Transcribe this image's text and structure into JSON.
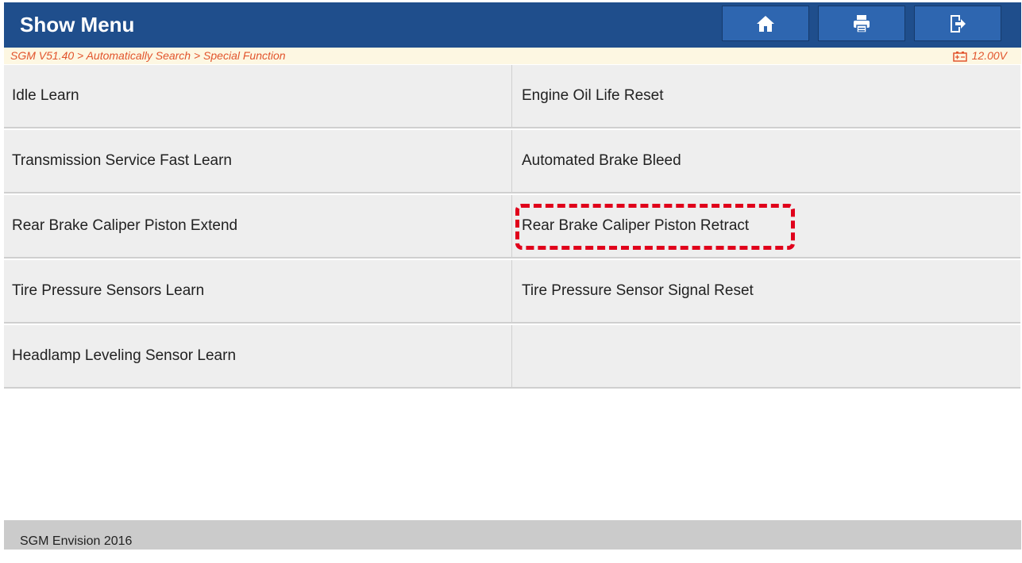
{
  "header": {
    "title": "Show Menu",
    "home_icon": "home-icon",
    "print_icon": "print-icon",
    "exit_icon": "exit-icon"
  },
  "breadcrumb": {
    "path": "SGM V51.40 > Automatically Search > Special Function",
    "voltage": "12.00V",
    "battery_icon": "battery-icon"
  },
  "menu": {
    "items": [
      {
        "label": "Idle Learn"
      },
      {
        "label": "Engine Oil Life Reset"
      },
      {
        "label": "Transmission Service Fast Learn"
      },
      {
        "label": "Automated Brake Bleed"
      },
      {
        "label": "Rear Brake Caliper Piston Extend"
      },
      {
        "label": "Rear Brake Caliper Piston Retract"
      },
      {
        "label": "Tire Pressure Sensors Learn"
      },
      {
        "label": "Tire Pressure Sensor Signal Reset"
      },
      {
        "label": "Headlamp Leveling Sensor Learn"
      },
      {
        "label": ""
      }
    ]
  },
  "footer": {
    "vehicle": "SGM Envision 2016"
  },
  "colors": {
    "header_bg": "#1f4e8c",
    "button_bg": "#2e66b0",
    "breadcrumb_text": "#e2542c",
    "highlight": "#e0001b"
  }
}
